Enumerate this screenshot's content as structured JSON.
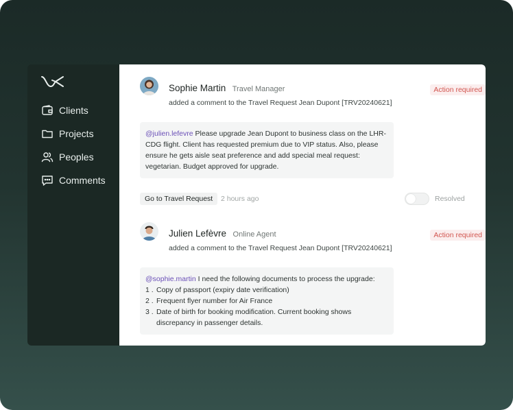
{
  "sidebar": {
    "logo_icon": "wave-logo-icon",
    "items": [
      {
        "label": "Clients",
        "icon": "wallet-icon"
      },
      {
        "label": "Projects",
        "icon": "folder-icon"
      },
      {
        "label": "Peoples",
        "icon": "users-icon"
      },
      {
        "label": "Comments",
        "icon": "comment-icon"
      }
    ]
  },
  "comments": [
    {
      "author": "Sophie Martin",
      "role": "Travel Manager",
      "subtitle": "added a comment to the Travel Request Jean Dupont [TRV20240621]",
      "badge": "Action required",
      "mention": "@julien.lefevre",
      "text": " Please upgrade Jean Dupont to business class on the LHR-CDG flight. Client has requested premium due to VIP status. Also, please ensure he gets aisle seat preference and add special meal request: vegetarian. Budget approved for upgrade."
    },
    {
      "author": "Julien Lefèvre",
      "role": "Online Agent",
      "subtitle": "added a comment to the Travel Request Jean Dupont [TRV20240621]",
      "badge": "Action required",
      "mention": "@sophie.martin",
      "text": " I need the following documents to process the upgrade:",
      "list": [
        {
          "num": "1 .",
          "text": "Copy of passport (expiry date verification)"
        },
        {
          "num": "2 .",
          "text": "Frequent flyer number for Air France"
        },
        {
          "num": "3 .",
          "text": "Date of birth for booking modification. Current booking shows discrepancy in passenger details."
        }
      ]
    }
  ],
  "actions": {
    "go_label": "Go to Travel Request",
    "time": "2 hours ago",
    "resolved_label": "Resolved",
    "resolved": false
  },
  "colors": {
    "sidebar_bg": "#1b2824",
    "badge_text": "#d1554f",
    "badge_bg": "#fbeeee",
    "mention": "#6a4fb7"
  }
}
